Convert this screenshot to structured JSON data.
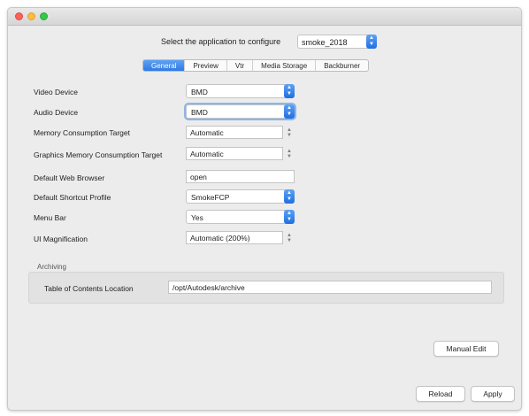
{
  "app_select": {
    "label": "Select the application to configure",
    "value": "smoke_2018"
  },
  "tabs": [
    {
      "label": "General",
      "active": true
    },
    {
      "label": "Preview",
      "active": false
    },
    {
      "label": "Vtr",
      "active": false
    },
    {
      "label": "Media Storage",
      "active": false
    },
    {
      "label": "Backburner",
      "active": false
    }
  ],
  "settings": {
    "video_device": {
      "label": "Video Device",
      "value": "BMD"
    },
    "audio_device": {
      "label": "Audio Device",
      "value": "BMD"
    },
    "memory_target": {
      "label": "Memory Consumption Target",
      "value": "Automatic"
    },
    "graphics_memory_target": {
      "label": "Graphics Memory Consumption Target",
      "value": "Automatic"
    },
    "web_browser": {
      "label": "Default Web Browser",
      "value": "open"
    },
    "shortcut_profile": {
      "label": "Default Shortcut Profile",
      "value": "SmokeFCP"
    },
    "menu_bar": {
      "label": "Menu Bar",
      "value": "Yes"
    },
    "ui_magnification": {
      "label": "UI Magnification",
      "value": "Automatic (200%)"
    }
  },
  "archiving": {
    "section_label": "Archiving",
    "toc_label": "Table of Contents Location",
    "toc_value": "/opt/Autodesk/archive"
  },
  "buttons": {
    "manual_edit": "Manual Edit",
    "reload": "Reload",
    "apply": "Apply"
  },
  "colors": {
    "accent": "#2f7ae6",
    "window_bg": "#ececec"
  }
}
